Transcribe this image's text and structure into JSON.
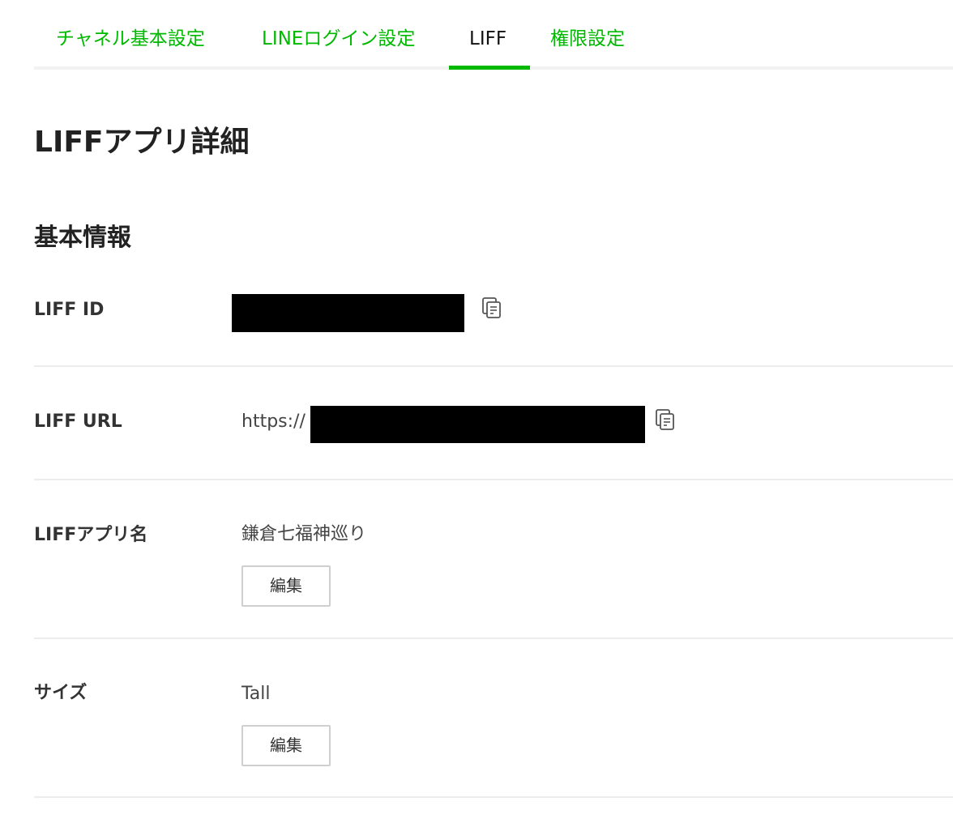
{
  "tabs": [
    {
      "label": "チャネル基本設定",
      "active": false
    },
    {
      "label": "LINEログイン設定",
      "active": false
    },
    {
      "label": "LIFF",
      "active": true
    },
    {
      "label": "権限設定",
      "active": false
    }
  ],
  "page_title": "LIFFアプリ詳細",
  "section_title": "基本情報",
  "rows": {
    "liff_id": {
      "label": "LIFF ID",
      "value": "[redacted]"
    },
    "liff_url": {
      "label": "LIFF URL",
      "prefix": "https://",
      "value": "[redacted]"
    },
    "app_name": {
      "label": "LIFFアプリ名",
      "value": "鎌倉七福神巡り",
      "edit_label": "編集"
    },
    "size": {
      "label": "サイズ",
      "value": "Tall",
      "edit_label": "編集"
    }
  },
  "icons": {
    "copy": "copy-icon"
  },
  "colors": {
    "accent": "#00b900",
    "text": "#333333",
    "divider": "#ececec"
  }
}
